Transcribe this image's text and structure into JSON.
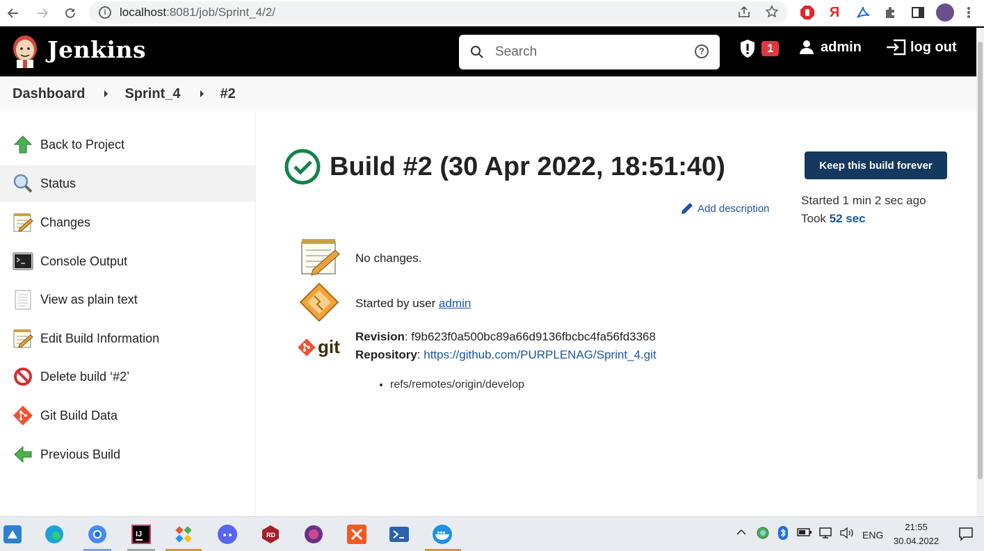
{
  "browser": {
    "url_host": "localhost",
    "url_rest": ":8081/job/Sprint_4/2/"
  },
  "header": {
    "brand": "Jenkins",
    "search_placeholder": "Search",
    "help": "?",
    "alerts_count": "1",
    "user": "admin",
    "logout": "log out"
  },
  "breadcrumbs": [
    "Dashboard",
    "Sprint_4",
    "#2"
  ],
  "sidebar": {
    "items": [
      {
        "label": "Back to Project",
        "icon": "up-arrow-icon"
      },
      {
        "label": "Status",
        "icon": "magnifier-icon"
      },
      {
        "label": "Changes",
        "icon": "notepad-icon"
      },
      {
        "label": "Console Output",
        "icon": "terminal-icon"
      },
      {
        "label": "View as plain text",
        "icon": "document-icon"
      },
      {
        "label": "Edit Build Information",
        "icon": "notepad-icon"
      },
      {
        "label": "Delete build ‘#2’",
        "icon": "no-entry-icon"
      },
      {
        "label": "Git Build Data",
        "icon": "git-icon"
      },
      {
        "label": "Previous Build",
        "icon": "left-arrow-icon"
      }
    ]
  },
  "build": {
    "title": "Build #2 (30 Apr 2022, 18:51:40)",
    "keep_button": "Keep this build forever",
    "add_description": "Add description",
    "started": "Started 1 min 2 sec ago",
    "took_prefix": "Took ",
    "took_value": "52 sec",
    "no_changes": "No changes.",
    "started_by_prefix": "Started by user ",
    "started_by_user": "admin",
    "revision_label": "Revision",
    "revision_value": ": f9b623f0a500bc89a66d9136fbcbc4fa56fd3368",
    "repository_label": "Repository",
    "repository_sep": ": ",
    "repository_url": "https://github.com/PURPLENAG/Sprint_4.git",
    "refs": [
      "refs/remotes/origin/develop"
    ],
    "git_text": "git"
  },
  "taskbar": {
    "language": "ENG",
    "time": "21:55",
    "date": "30.04.2022"
  },
  "colors": {
    "header_bg": "#000000",
    "link": "#1a55a7",
    "button_bg": "#14385e",
    "success": "#138347",
    "badge": "#e2363e"
  }
}
